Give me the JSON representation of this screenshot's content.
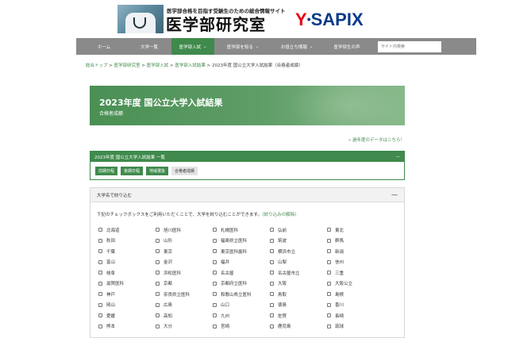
{
  "header": {
    "tagline": "医学部合格を目指す受験生のための総合情報サイト",
    "site_title": "医学部研究室",
    "sapix_y": "Y",
    "sapix_dot": "•",
    "sapix_rest": "SAPIX"
  },
  "nav": {
    "items": [
      {
        "label": "ホーム",
        "caret": ""
      },
      {
        "label": "大学一覧",
        "caret": ""
      },
      {
        "label": "医学部入試",
        "caret": "⌄"
      },
      {
        "label": "医学部を知る",
        "caret": "⌄"
      },
      {
        "label": "お役立ち情報",
        "caret": "⌄"
      },
      {
        "label": "医学部生の声",
        "caret": ""
      }
    ],
    "search_placeholder": "サイト内検索"
  },
  "breadcrumb": {
    "items": [
      "総合トップ",
      "医学部研究室",
      "医学部入試",
      "医学部入試結果"
    ],
    "separator": ">",
    "current": "2023年度 国公立大学入試結果（合格者成績）"
  },
  "hero": {
    "title": "2023年度 国公立大学入試結果",
    "subtitle": "合格者成績"
  },
  "past_link": "» 過年度のデータはこちら！",
  "results_box": {
    "title": "2023年度 国公立大学入試結果 一覧",
    "toggle": "—",
    "tabs": [
      "前期日程",
      "後期日程",
      "地域選抜",
      "合格者成績"
    ]
  },
  "filter_box": {
    "title": "大学名で絞り込む",
    "toggle": "—",
    "description": "下記のチェックボックスをご利用いただくことで、大学を絞り込むことができます。",
    "clear_link": "（絞り込みの解除）",
    "universities": [
      "北海道",
      "旭川医科",
      "札幌医科",
      "弘前",
      "東北",
      "秋田",
      "山形",
      "福島県立医科",
      "筑波",
      "群馬",
      "千葉",
      "東京",
      "東京医科歯科",
      "横浜市立",
      "新潟",
      "富山",
      "金沢",
      "福井",
      "山梨",
      "信州",
      "岐阜",
      "浜松医科",
      "名古屋",
      "名古屋市立",
      "三重",
      "滋賀医科",
      "京都",
      "京都府立医科",
      "大阪",
      "大阪公立",
      "神戸",
      "奈良県立医科",
      "和歌山県立医科",
      "鳥取",
      "島根",
      "岡山",
      "広島",
      "山口",
      "徳島",
      "香川",
      "愛媛",
      "高知",
      "九州",
      "佐賀",
      "長崎",
      "熊本",
      "大分",
      "宮崎",
      "鹿児島",
      "琉球"
    ]
  }
}
